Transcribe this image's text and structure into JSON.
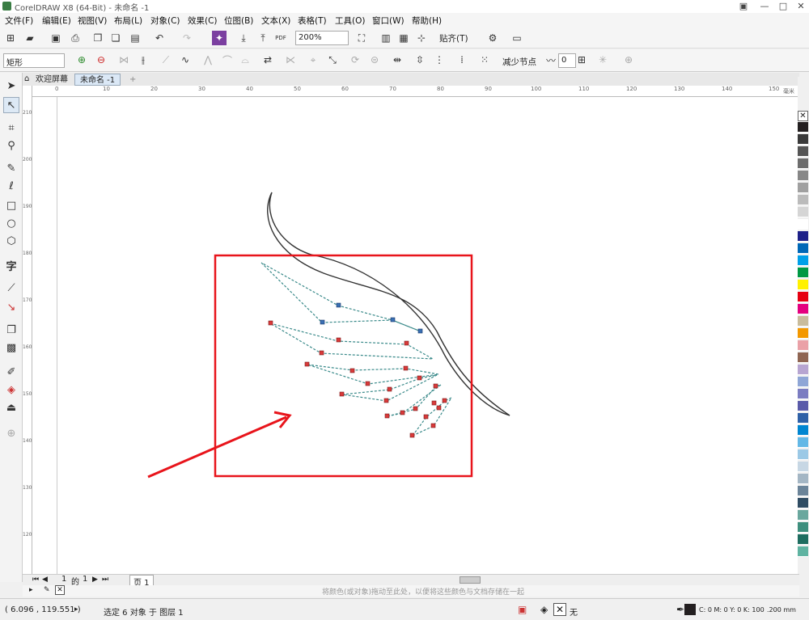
{
  "window": {
    "title": "CorelDRAW X8 (64-Bit) - 未命名 -1",
    "min": "—",
    "max": "□",
    "close": "✕",
    "restore": "▣"
  },
  "menu": [
    "文件(F)",
    "编辑(E)",
    "视图(V)",
    "布局(L)",
    "对象(C)",
    "效果(C)",
    "位图(B)",
    "文本(X)",
    "表格(T)",
    "工具(O)",
    "窗口(W)",
    "帮助(H)"
  ],
  "toolbar": {
    "zoom": "200%",
    "snap_label": "贴齐(T)",
    "pdf": "PDF"
  },
  "property_bar": {
    "shape_select": "矩形",
    "reduce_nodes": "减少节点",
    "smoothness": "0"
  },
  "tabs": {
    "welcome": "欢迎屏幕",
    "doc": "未命名 -1",
    "add": "+"
  },
  "ruler_h": [
    "0",
    "10",
    "20",
    "30",
    "40",
    "50",
    "60",
    "70",
    "80",
    "90",
    "100",
    "110",
    "120",
    "130",
    "140",
    "150",
    "毫米"
  ],
  "ruler_v": [
    "210",
    "200",
    "190",
    "180",
    "170",
    "160",
    "150",
    "140",
    "130",
    "120"
  ],
  "page_nav": {
    "current": "1",
    "of": "的",
    "total": "1",
    "page_tab": "页 1"
  },
  "hint": "将颜色(或对象)拖动至此处，以便将这些颜色与文档存储在一起",
  "status": {
    "coords": "( 6.096 , 119.551 )",
    "selection": "选定 6 对象 于 图层 1",
    "fill_none": "无",
    "cmyk": "C: 0 M: 0 Y: 0 K: 100",
    "width": ".200 mm"
  },
  "palette_colors": [
    "#231f20",
    "#3a3a3a",
    "#555",
    "#6d6d6d",
    "#878787",
    "#a0a0a0",
    "#bbbbbb",
    "#d5d5d5",
    "#ffffff",
    "#1d2088",
    "#0068b7",
    "#00a0e9",
    "#009944",
    "#fff100",
    "#e60012",
    "#e4007f",
    "#c9bc9c",
    "#f39800",
    "#eaa1a7",
    "#8f6552",
    "#b7a5d1",
    "#8fa6d6",
    "#7b7cc1",
    "#5a5ba9",
    "#2f61a7",
    "#0086d1",
    "#63b8e6",
    "#9bc9e6",
    "#c7d7e4",
    "#a4b6c4",
    "#6b8499",
    "#2f4c63",
    "#6aa79e",
    "#3e8f7e",
    "#1e6d60",
    "#5fb3a1"
  ],
  "annotation": {
    "frame_color": "#e8141b",
    "arrow_color": "#e8141b"
  }
}
